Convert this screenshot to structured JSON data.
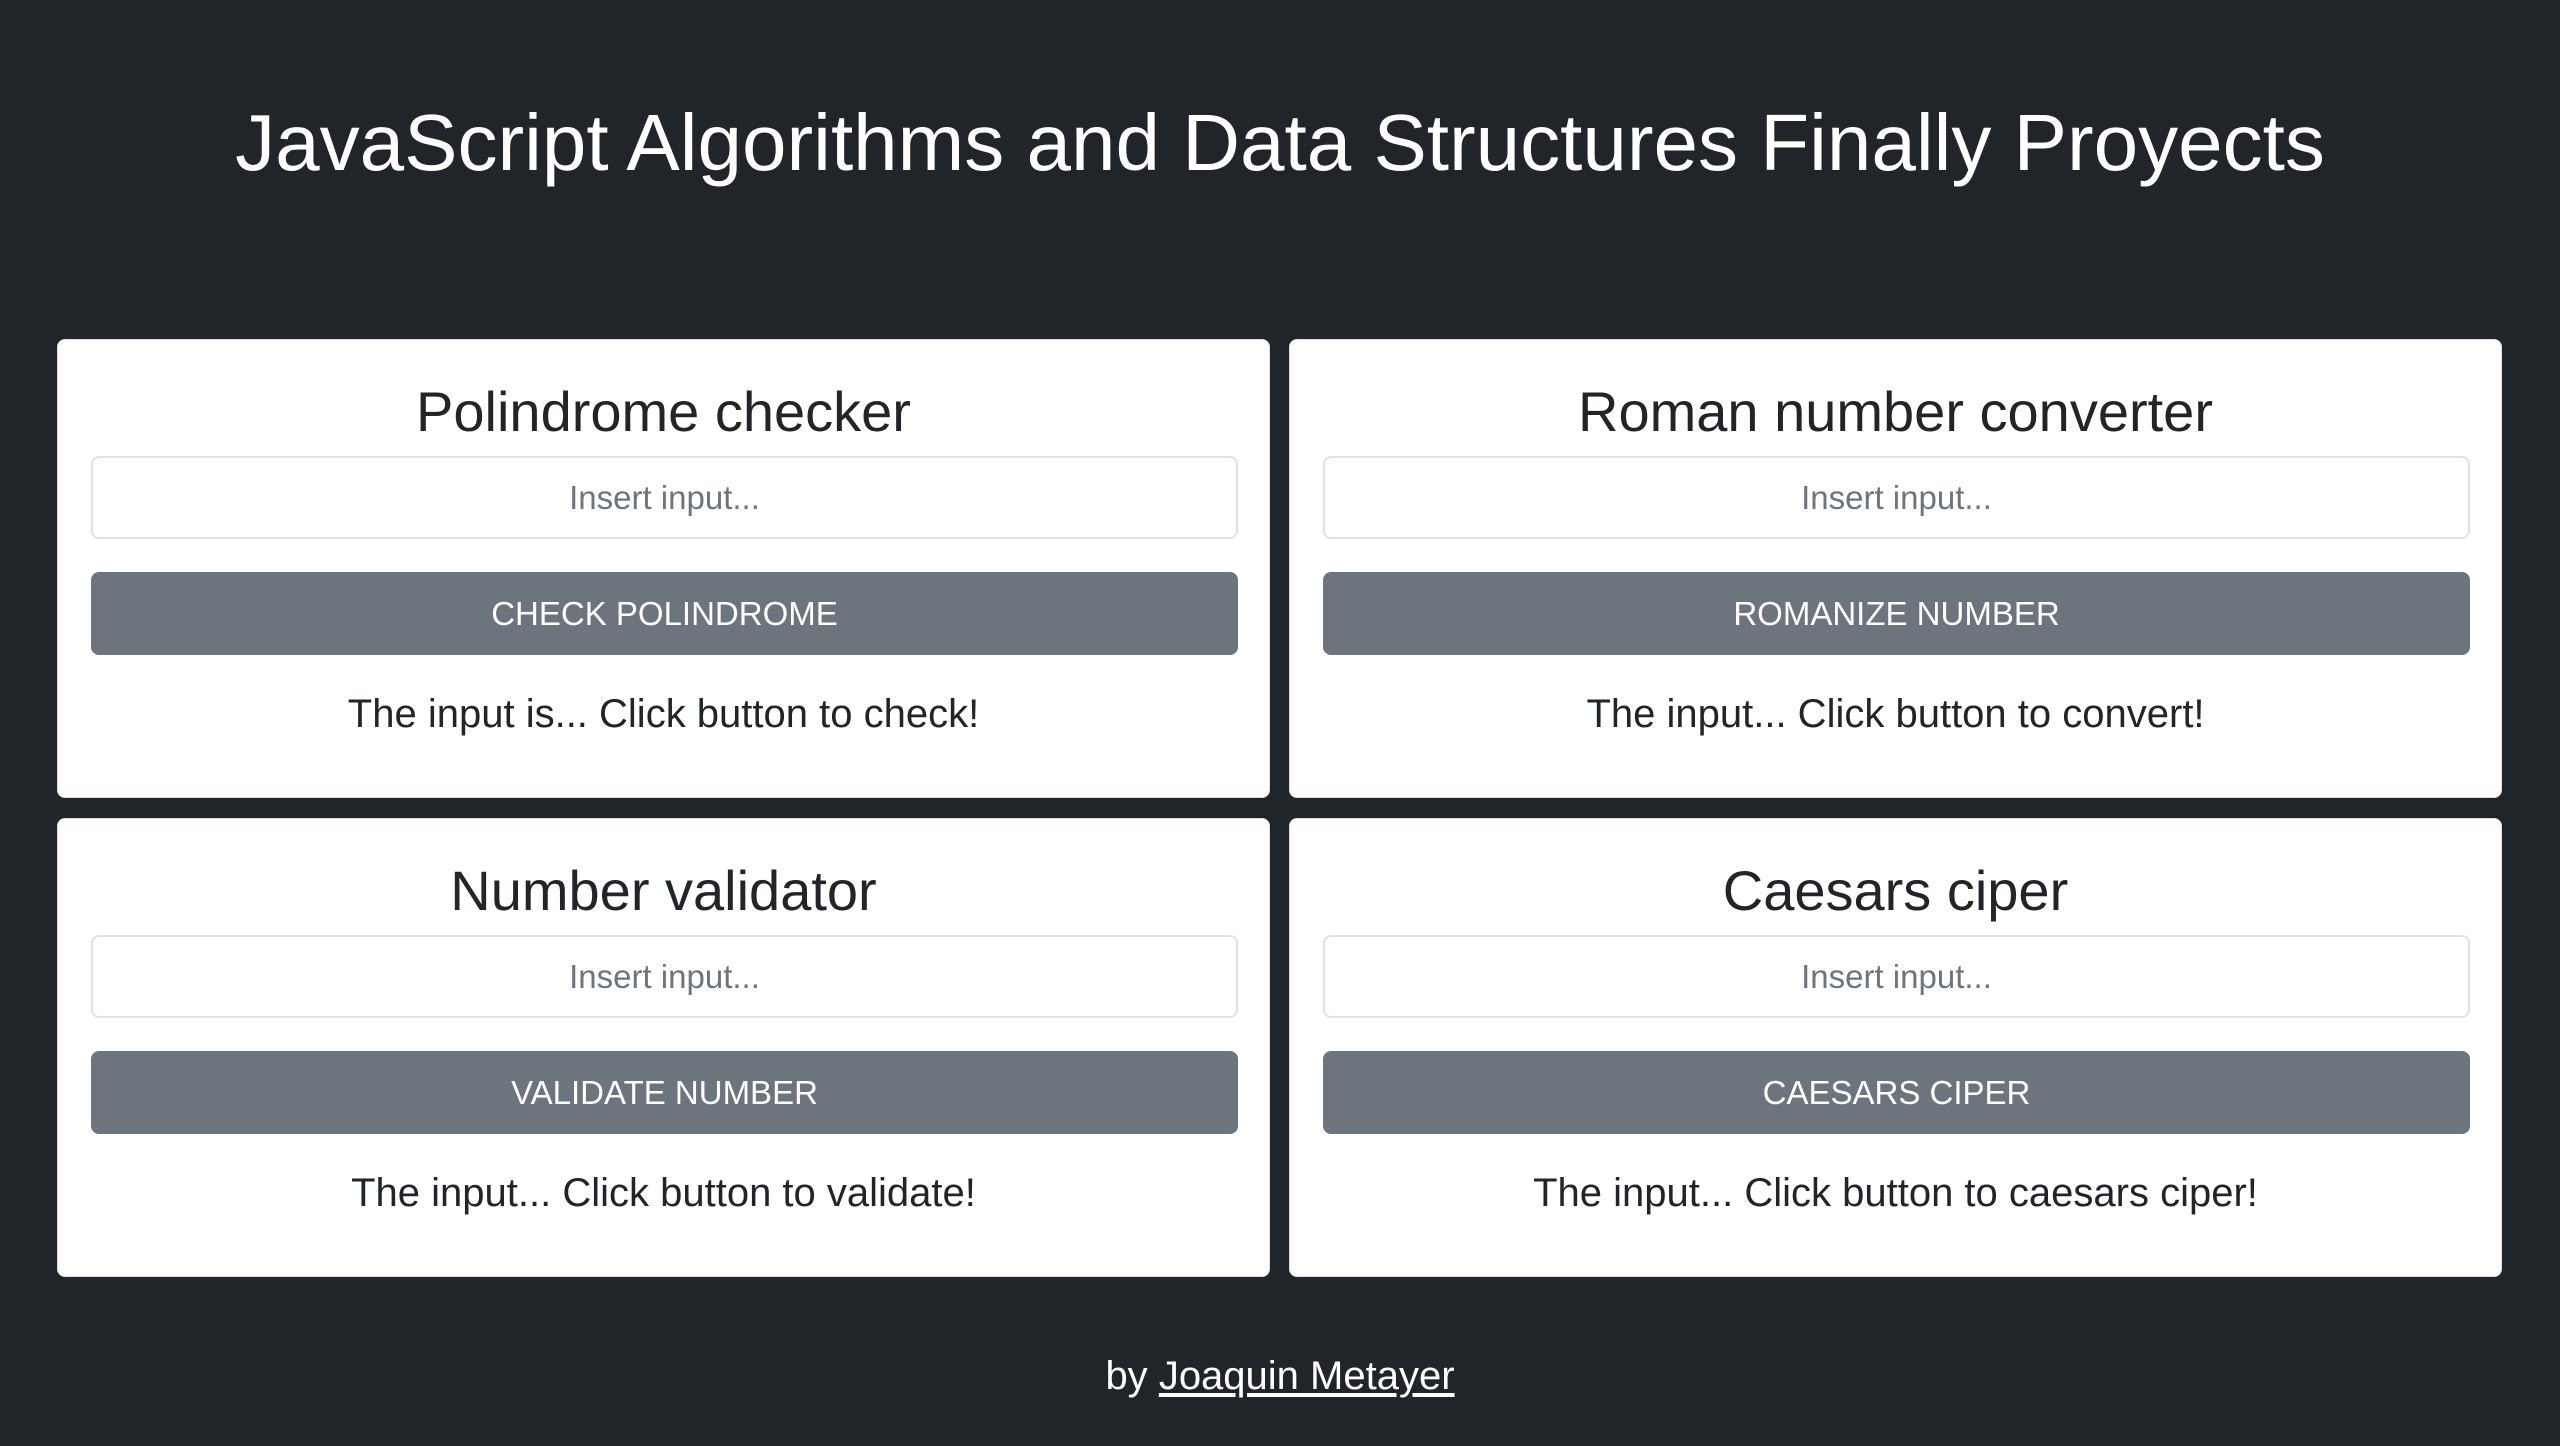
{
  "header": {
    "title": "JavaScript Algorithms and Data Structures Finally Proyects"
  },
  "cards": [
    {
      "title": "Polindrome checker",
      "input_placeholder": "Insert input...",
      "input_value": "",
      "button_label": "CHECK POLINDROME",
      "result_text": "The input is... Click button to check!"
    },
    {
      "title": "Roman number converter",
      "input_placeholder": "Insert input...",
      "input_value": "",
      "button_label": "ROMANIZE NUMBER",
      "result_text": "The input... Click button to convert!"
    },
    {
      "title": "Number validator",
      "input_placeholder": "Insert input...",
      "input_value": "",
      "button_label": "VALIDATE NUMBER",
      "result_text": "The input... Click button to validate!"
    },
    {
      "title": "Caesars ciper",
      "input_placeholder": "Insert input...",
      "input_value": "",
      "button_label": "CAESARS CIPER",
      "result_text": "The input... Click button to caesars ciper!"
    }
  ],
  "footer": {
    "prefix": "by",
    "author_link": "Joaquin Metayer"
  },
  "colors": {
    "background": "#212529",
    "card_background": "#ffffff",
    "button": "#6c757d",
    "text_dark": "#212529",
    "text_light": "#ffffff"
  }
}
